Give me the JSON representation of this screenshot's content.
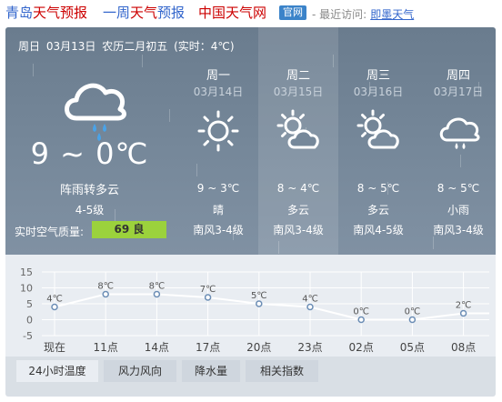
{
  "topbar": {
    "city": "青岛",
    "link1": "天气预报",
    "link2_prefix": "一周",
    "link2_red": "天气",
    "link2_suffix": "预报",
    "link3": "中国天气网",
    "badge": "官网",
    "visited_label": "- 最近访问:",
    "visited_link": "即墨天气"
  },
  "today": {
    "weekday": "周日",
    "date": "03月13日",
    "lunar": "农历二月初五",
    "realtime": "(实时：4℃)",
    "temp": "9 ~ 0℃",
    "desc": "阵雨转多云",
    "wind": "4-5级",
    "aqi_label": "实时空气质量:",
    "aqi_value": "69 良",
    "icon": "cloud-rain-icon"
  },
  "days": [
    {
      "name": "周一",
      "date": "03月14日",
      "icon": "sun-icon",
      "temp": "9 ~ 3℃",
      "weather": "晴",
      "wind": "南风3-4级",
      "active": false
    },
    {
      "name": "周二",
      "date": "03月15日",
      "icon": "partly-cloudy-icon",
      "temp": "8 ~ 4℃",
      "weather": "多云",
      "wind": "南风3-4级",
      "active": true
    },
    {
      "name": "周三",
      "date": "03月16日",
      "icon": "partly-cloudy-icon",
      "temp": "8 ~ 5℃",
      "weather": "多云",
      "wind": "南风4-5级",
      "active": false
    },
    {
      "name": "周四",
      "date": "03月17日",
      "icon": "light-rain-icon",
      "temp": "8 ~ 5℃",
      "weather": "小雨",
      "wind": "南风3-4级",
      "active": false
    }
  ],
  "tabs": [
    {
      "label": "24小时温度",
      "active": true
    },
    {
      "label": "风力风向",
      "active": false
    },
    {
      "label": "降水量",
      "active": false
    },
    {
      "label": "相关指数",
      "active": false
    }
  ],
  "chart_data": {
    "type": "line",
    "title": "",
    "xlabel": "",
    "ylabel": "",
    "categories": [
      "现在",
      "11点",
      "14点",
      "17点",
      "20点",
      "23点",
      "02点",
      "05点",
      "08点"
    ],
    "values": [
      4,
      8,
      8,
      7,
      5,
      4,
      0,
      0,
      2
    ],
    "value_labels": [
      "4℃",
      "8℃",
      "8℃",
      "7℃",
      "5℃",
      "4℃",
      "0℃",
      "0℃",
      "2℃"
    ],
    "yticks": [
      15,
      10,
      5,
      0,
      -5
    ],
    "ylim": [
      -5,
      15
    ],
    "grid": true,
    "colors": {
      "line": "#ffffff",
      "marker_fill": "#ffffff",
      "marker_stroke": "#6b8db5",
      "grid": "#ffffff"
    }
  }
}
